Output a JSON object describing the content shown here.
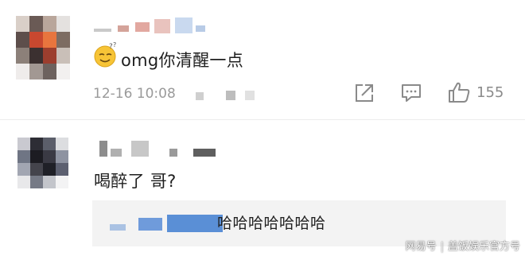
{
  "comments": [
    {
      "text": "omg你清醒一点",
      "timestamp": "12-16 10:08",
      "emoji_icon": "sweat-smile-emoji-icon",
      "actions": {
        "share_icon": "share-icon",
        "comment_icon": "comment-icon",
        "like_icon": "thumbs-up-icon",
        "like_count": "155"
      }
    },
    {
      "text": "喝醉了 哥?",
      "reply": {
        "text": "哈哈哈哈哈哈哈"
      }
    }
  ],
  "watermark": {
    "left": "网易号",
    "right": "盖饭娱乐官方号"
  },
  "colors": {
    "reply_name_blue": "#5a8fd6",
    "background": "#ffffff",
    "reply_box": "#f3f3f3",
    "text_gray": "#9a9a9a"
  }
}
